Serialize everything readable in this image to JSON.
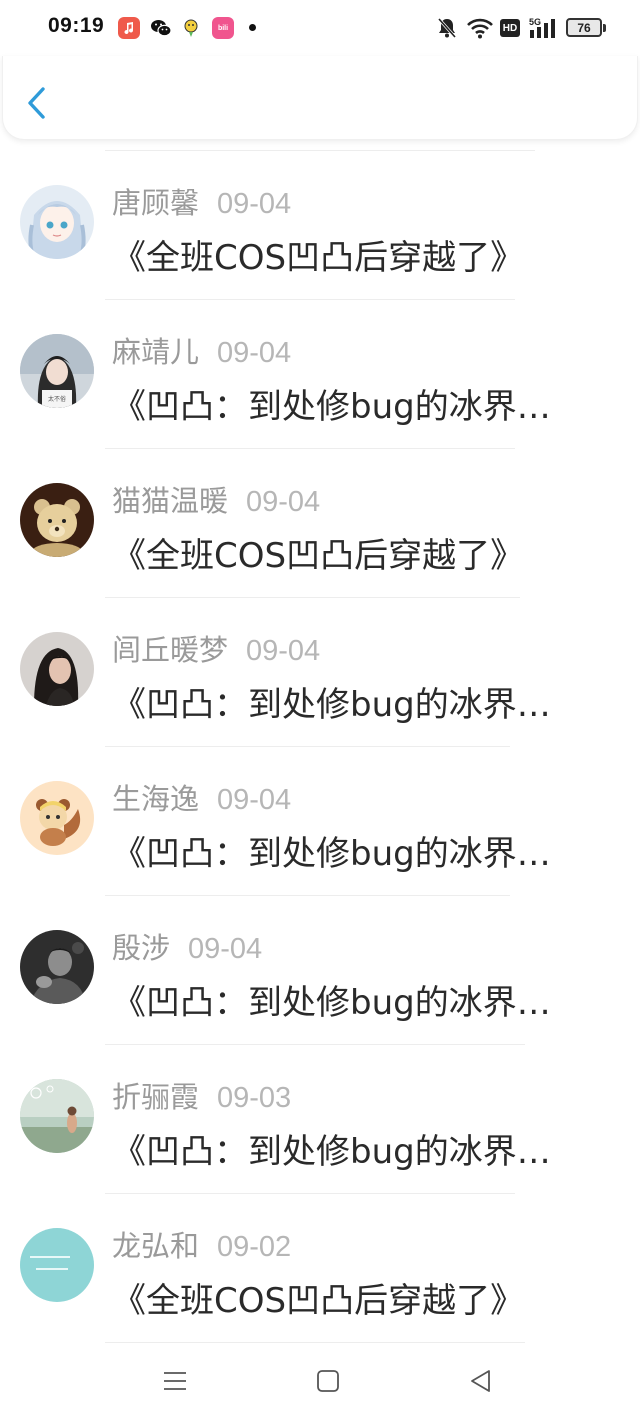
{
  "status_bar": {
    "time": "09:19",
    "app_icons": [
      "music-app-icon",
      "wechat-icon",
      "bird-app-icon",
      "bilibili-icon"
    ],
    "bili_label": "bili",
    "network": "5G",
    "hd": "HD",
    "battery": "76"
  },
  "header": {
    "back_icon": "chevron-left-icon",
    "accent_color": "#2f9bd9"
  },
  "comments": [
    {
      "name": "唐顾馨",
      "date": "09-04",
      "title": "《全班COS凹凸后穿越了》",
      "avatar": "anime-girl-avatar"
    },
    {
      "name": "麻靖儿",
      "date": "09-04",
      "title": "《凹凸：到处修bug的冰界…",
      "avatar": "girl-photo-avatar"
    },
    {
      "name": "猫猫温暖",
      "date": "09-04",
      "title": "《全班COS凹凸后穿越了》",
      "avatar": "teddy-bear-avatar"
    },
    {
      "name": "闾丘暖梦",
      "date": "09-04",
      "title": "《凹凸：到处修bug的冰界…",
      "avatar": "woman-portrait-avatar"
    },
    {
      "name": "生海逸",
      "date": "09-04",
      "title": "《凹凸：到处修bug的冰界…",
      "avatar": "cartoon-squirrel-avatar"
    },
    {
      "name": "殷涉",
      "date": "09-04",
      "title": "《凹凸：到处修bug的冰界…",
      "avatar": "man-bw-avatar"
    },
    {
      "name": "折骊霞",
      "date": "09-03",
      "title": "《凹凸：到处修bug的冰界…",
      "avatar": "outdoor-child-avatar"
    },
    {
      "name": "龙弘和",
      "date": "09-02",
      "title": "《全班COS凹凸后穿越了》",
      "avatar": "teal-text-avatar"
    }
  ],
  "navbar": {
    "icons": [
      "menu-icon",
      "home-square-icon",
      "back-triangle-icon"
    ]
  }
}
